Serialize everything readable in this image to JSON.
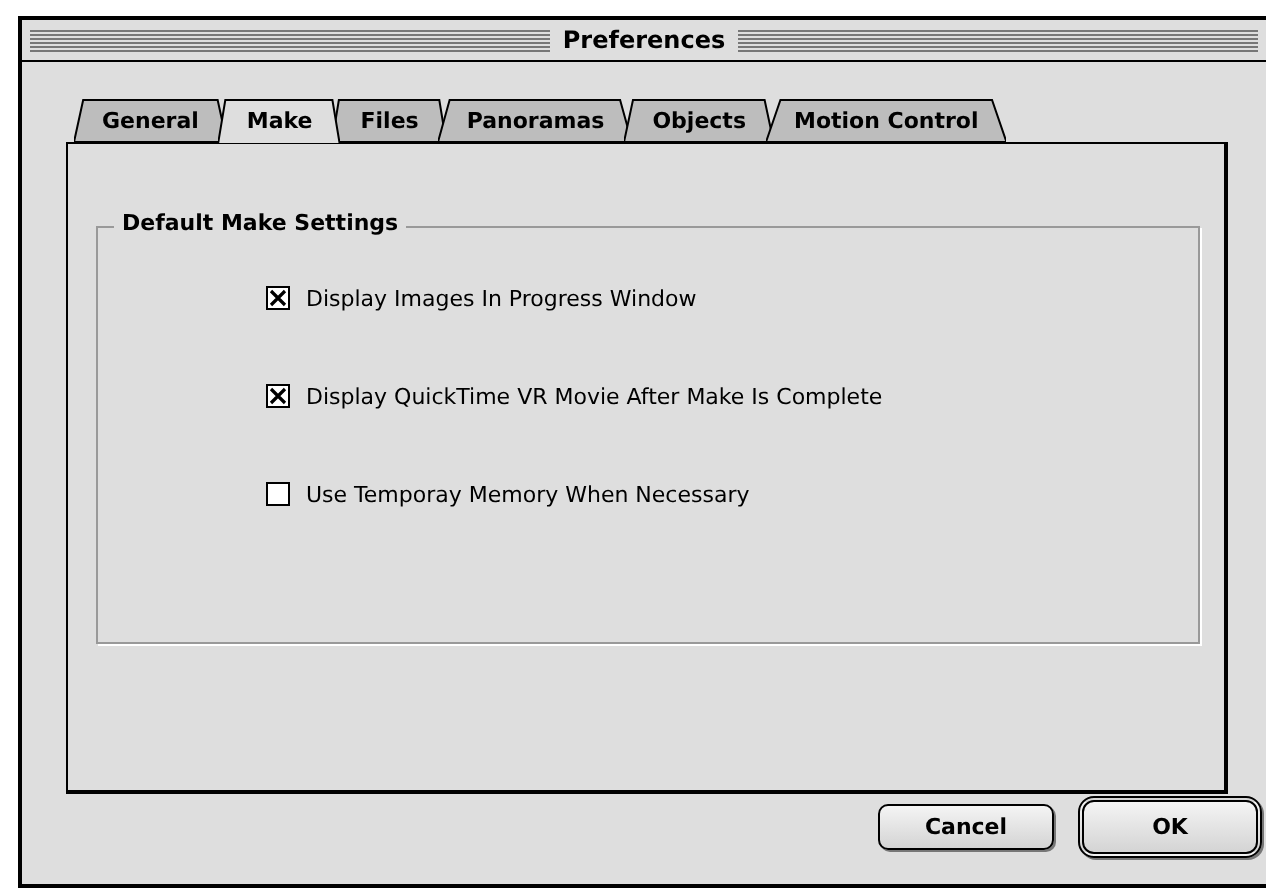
{
  "window": {
    "title": "Preferences"
  },
  "tabs": [
    {
      "label": "General",
      "selected": false
    },
    {
      "label": "Make",
      "selected": true
    },
    {
      "label": "Files",
      "selected": false
    },
    {
      "label": "Panoramas",
      "selected": false
    },
    {
      "label": "Objects",
      "selected": false
    },
    {
      "label": "Motion Control",
      "selected": false
    }
  ],
  "group": {
    "title": "Default Make Settings",
    "options": [
      {
        "label": "Display Images In Progress Window",
        "checked": true
      },
      {
        "label": "Display QuickTime VR Movie After Make Is Complete",
        "checked": true
      },
      {
        "label": "Use Temporay Memory When Necessary",
        "checked": false
      }
    ]
  },
  "buttons": [
    {
      "label": "Cancel",
      "default": false
    },
    {
      "label": "OK",
      "default": true
    }
  ]
}
